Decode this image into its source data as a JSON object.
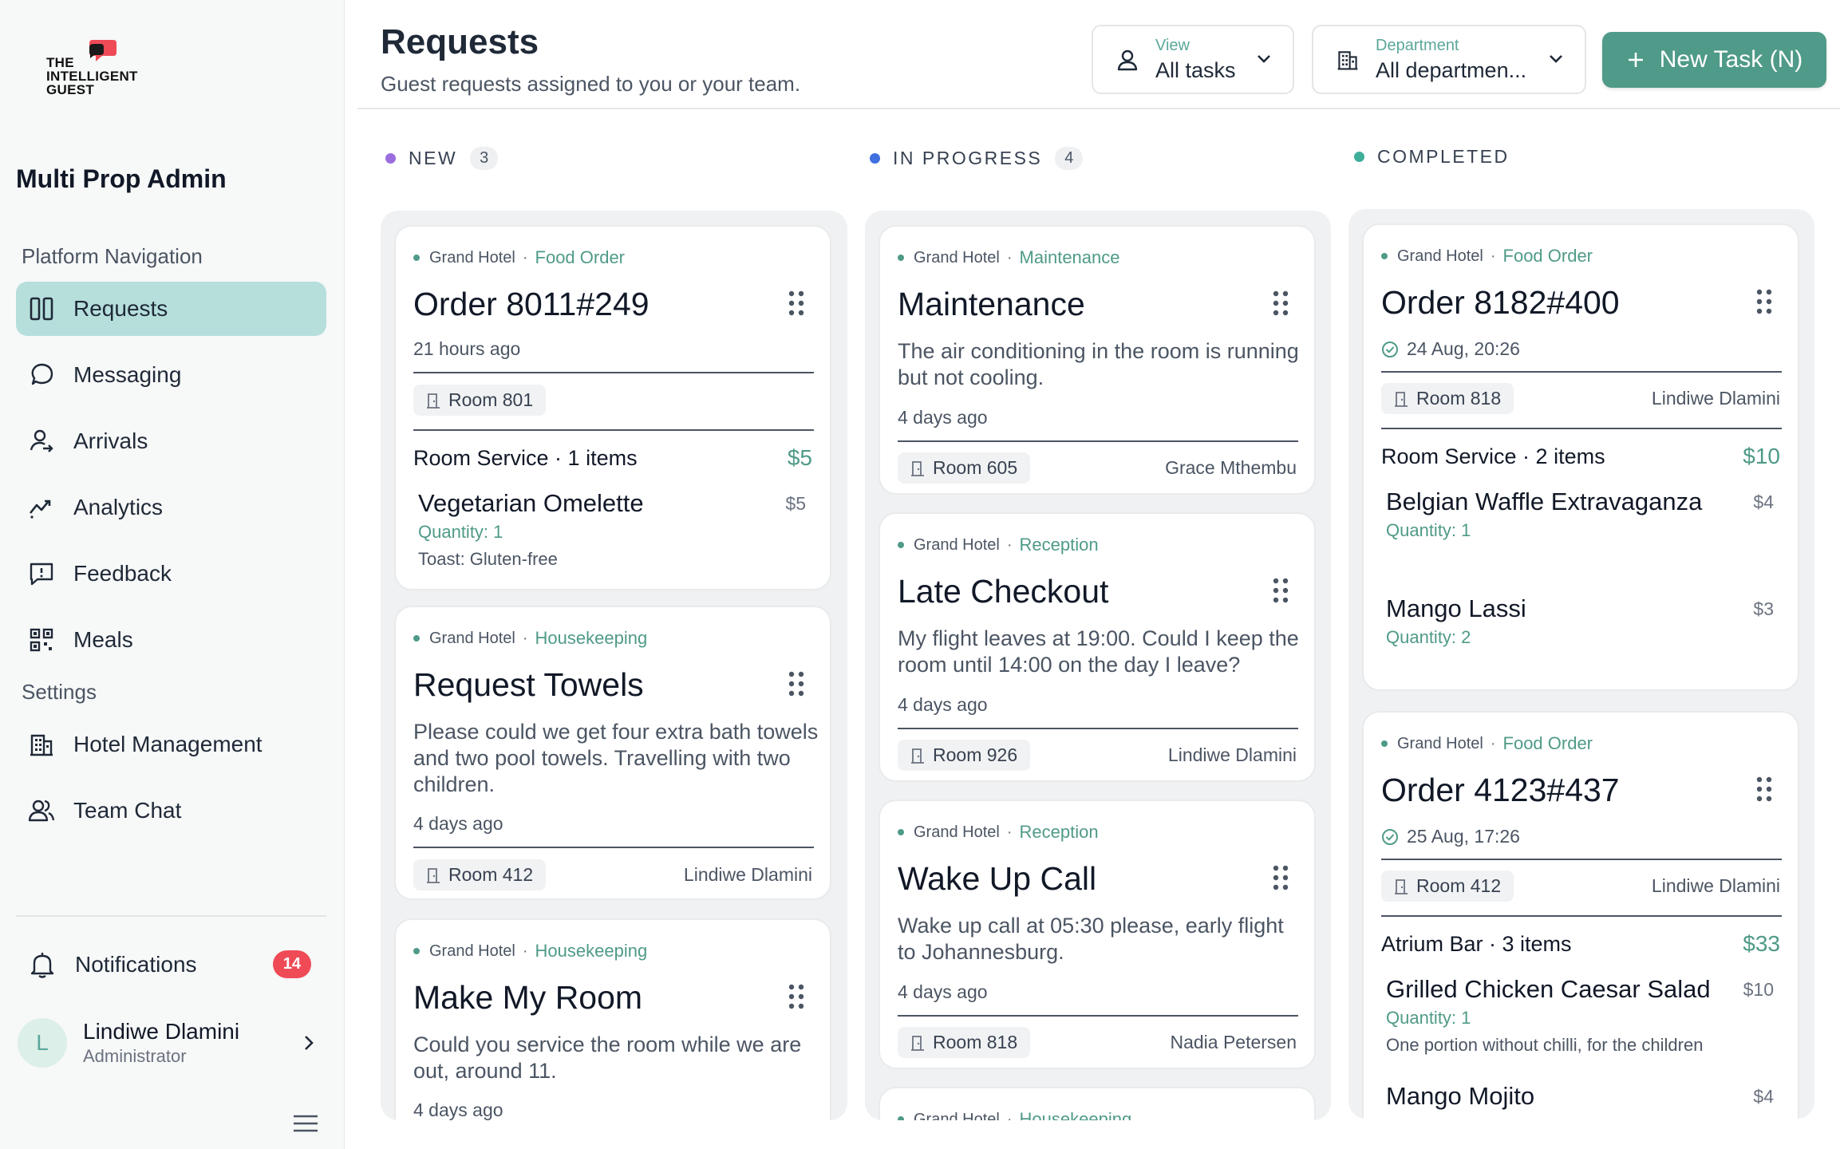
{
  "brand": {
    "logo_text_1": "THE",
    "logo_text_2": "INTELLIGENT",
    "logo_text_3": "GUEST"
  },
  "sidebar": {
    "workspace": "Multi Prop Admin",
    "platform_label": "Platform Navigation",
    "settings_label": "Settings",
    "nav": [
      {
        "label": "Requests",
        "icon": "columns-icon"
      },
      {
        "label": "Messaging",
        "icon": "chat-bubble-icon"
      },
      {
        "label": "Arrivals",
        "icon": "user-arrival-icon"
      },
      {
        "label": "Analytics",
        "icon": "trend-chart-icon"
      },
      {
        "label": "Feedback",
        "icon": "feedback-icon"
      },
      {
        "label": "Meals",
        "icon": "qr-code-icon"
      }
    ],
    "settings": [
      {
        "label": "Hotel Management",
        "icon": "building-icon"
      },
      {
        "label": "Team Chat",
        "icon": "team-icon"
      }
    ],
    "notifications": {
      "label": "Notifications",
      "count": "14"
    },
    "user": {
      "initial": "L",
      "name": "Lindiwe Dlamini",
      "role": "Administrator"
    }
  },
  "header": {
    "title": "Requests",
    "subtitle": "Guest requests assigned to you or your team.",
    "view": {
      "label": "View",
      "value": "All tasks"
    },
    "department": {
      "label": "Department",
      "value": "All departmen..."
    },
    "new_task": "New Task (N)"
  },
  "colors": {
    "accent": "#4f9a88",
    "new": "#9b6ee0",
    "in_progress": "#3f6fe0",
    "completed": "#3fae9a",
    "badge": "#ef4b57"
  },
  "columns": {
    "new": {
      "title": "NEW",
      "count": "3",
      "cards": [
        {
          "hotel": "Grand Hotel",
          "category": "Food Order",
          "title": "Order 8011#249",
          "time": "21 hours ago",
          "room": "Room 801",
          "service": "Room Service · 1 items",
          "total": "$5",
          "items": [
            {
              "name": "Vegetarian Omelette",
              "price": "$5",
              "qty": "Quantity: 1",
              "note": "Toast: Gluten-free"
            }
          ]
        },
        {
          "hotel": "Grand Hotel",
          "category": "Housekeeping",
          "title": "Request Towels",
          "desc": "Please could we get four extra bath towels and two pool towels. Travelling with two children.",
          "time": "4 days ago",
          "room": "Room 412",
          "assignee": "Lindiwe Dlamini"
        },
        {
          "hotel": "Grand Hotel",
          "category": "Housekeeping",
          "title": "Make My Room",
          "desc": "Could you service the room while we are out, around 11.",
          "time": "4 days ago"
        }
      ]
    },
    "in_progress": {
      "title": "IN PROGRESS",
      "count": "4",
      "cards": [
        {
          "hotel": "Grand Hotel",
          "category": "Maintenance",
          "title": "Maintenance",
          "desc": "The air conditioning in the room is running but not cooling.",
          "time": "4 days ago",
          "room": "Room 605",
          "assignee": "Grace Mthembu"
        },
        {
          "hotel": "Grand Hotel",
          "category": "Reception",
          "title": "Late Checkout",
          "desc": "My flight leaves at 19:00. Could I keep the room until 14:00 on the day I leave?",
          "time": "4 days ago",
          "room": "Room 926",
          "assignee": "Lindiwe Dlamini"
        },
        {
          "hotel": "Grand Hotel",
          "category": "Reception",
          "title": "Wake Up Call",
          "desc": "Wake up call at 05:30 please, early flight to Johannesburg.",
          "time": "4 days ago",
          "room": "Room 818",
          "assignee": "Nadia Petersen"
        },
        {
          "hotel": "Grand Hotel",
          "category": "Housekeeping"
        }
      ]
    },
    "completed": {
      "title": "COMPLETED",
      "cards": [
        {
          "hotel": "Grand Hotel",
          "category": "Food Order",
          "title": "Order 8182#400",
          "time": "24 Aug, 20:26",
          "room": "Room 818",
          "assignee": "Lindiwe Dlamini",
          "service": "Room Service · 2 items",
          "total": "$10",
          "items": [
            {
              "name": "Belgian Waffle Extravaganza",
              "price": "$4",
              "qty": "Quantity: 1"
            },
            {
              "name": "Mango Lassi",
              "price": "$3",
              "qty": "Quantity: 2"
            }
          ]
        },
        {
          "hotel": "Grand Hotel",
          "category": "Food Order",
          "title": "Order 4123#437",
          "time": "25 Aug, 17:26",
          "room": "Room 412",
          "assignee": "Lindiwe Dlamini",
          "service": "Atrium Bar · 3 items",
          "total": "$33",
          "items": [
            {
              "name": "Grilled Chicken Caesar Salad",
              "price": "$10",
              "qty": "Quantity: 1",
              "note": "One portion without chilli, for the children"
            },
            {
              "name": "Mango Mojito",
              "price": "$4"
            }
          ]
        }
      ]
    }
  }
}
